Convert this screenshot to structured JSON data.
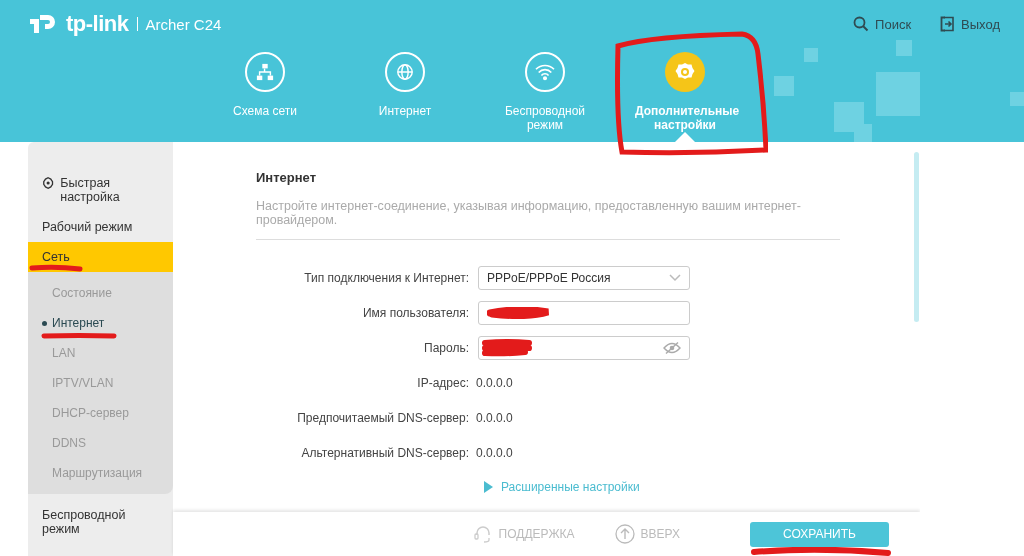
{
  "header": {
    "brand": "tp-link",
    "model": "Archer C24",
    "links": [
      {
        "kind": "search",
        "label": "Поиск"
      },
      {
        "kind": "logout",
        "label": "Выход"
      }
    ]
  },
  "tabs": [
    {
      "kind": "network",
      "label": "Схема сети",
      "selected": false
    },
    {
      "kind": "globe",
      "label": "Интернет",
      "selected": false
    },
    {
      "kind": "wifi",
      "label": "Беспроводной режим",
      "selected": false
    },
    {
      "kind": "gear",
      "label": "Дополнительные настройки",
      "selected": true
    }
  ],
  "sidebar": {
    "items": [
      {
        "label": "Быстрая настройка",
        "kind": "gear",
        "selected": false
      },
      {
        "label": "Рабочий режим",
        "selected": false
      },
      {
        "label": "Сеть",
        "selected": true,
        "expanded": true,
        "children": [
          {
            "label": "Состояние",
            "selected": false
          },
          {
            "label": "Интернет",
            "selected": true
          },
          {
            "label": "LAN",
            "selected": false
          },
          {
            "label": "IPTV/VLAN",
            "selected": false
          },
          {
            "label": "DHCP-сервер",
            "selected": false
          },
          {
            "label": "DDNS",
            "selected": false
          },
          {
            "label": "Маршрутизация",
            "selected": false
          }
        ]
      },
      {
        "label": "Беспроводной режим",
        "selected": false
      }
    ]
  },
  "content": {
    "title": "Интернет",
    "description": "Настройте интернет-соединение, указывая информацию, предоставленную вашим интернет-провайдером.",
    "rows": [
      {
        "kind": "select",
        "label": "Тип подключения к Интернет:",
        "value": "PPPoE/PPPoE Россия"
      },
      {
        "kind": "text",
        "label": "Имя пользователя:"
      },
      {
        "kind": "password",
        "label": "Пароль:"
      },
      {
        "kind": "static",
        "label": "IP-адрес:",
        "value": "0.0.0.0"
      },
      {
        "kind": "static",
        "label": "Предпочитаемый DNS-сервер:",
        "value": "0.0.0.0"
      },
      {
        "kind": "static",
        "label": "Альтернативный DNS-сервер:",
        "value": "0.0.0.0"
      }
    ],
    "advanced_link": "Расширенные настройки"
  },
  "footer": {
    "support": "ПОДДЕРЖКА",
    "up": "ВВЕРХ",
    "save": "СОХРАНИТЬ"
  }
}
